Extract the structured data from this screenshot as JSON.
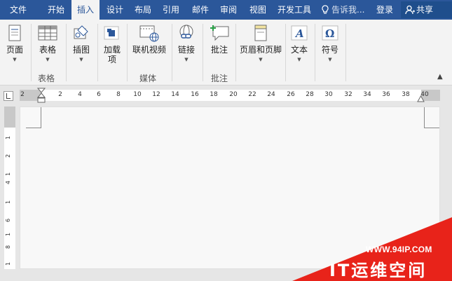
{
  "menubar": {
    "tabs": [
      "文件",
      "开始",
      "插入",
      "设计",
      "布局",
      "引用",
      "邮件",
      "审阅",
      "视图",
      "开发工具"
    ],
    "active_tab": "插入",
    "tell_me": "告诉我...",
    "login": "登录",
    "share": "共享",
    "colors": {
      "bar": "#2b579a",
      "active_tab_bg": "#f3f3f3"
    }
  },
  "ribbon": {
    "buttons": {
      "page": "页面",
      "table": "表格",
      "illustrations": "插图",
      "addins": "加载项",
      "online_video": "联机视频",
      "link": "链接",
      "comment": "批注",
      "header_footer": "页眉和页脚",
      "text": "文本",
      "symbol": "符号"
    },
    "groups": {
      "table": "表格",
      "media": "媒体",
      "comments": "批注"
    },
    "icons": [
      "page-icon",
      "table-icon",
      "illustrations-icon",
      "addins-icon",
      "online-video-icon",
      "link-icon",
      "comment-icon",
      "header-footer-icon",
      "text-icon",
      "symbol-icon"
    ]
  },
  "ruler": {
    "labels": [
      "2",
      "2",
      "4",
      "6",
      "8",
      "10",
      "12",
      "14",
      "16",
      "18",
      "20",
      "22",
      "24",
      "26",
      "28",
      "30",
      "32",
      "34",
      "36",
      "38",
      "40"
    ],
    "vertical_labels": [
      "1",
      "2",
      "1",
      "4",
      "1",
      "6",
      "1",
      "8",
      "1"
    ]
  },
  "watermark": {
    "url": "WWW.94IP.COM",
    "brand": "IT运维空间",
    "color": "#e8231a"
  }
}
